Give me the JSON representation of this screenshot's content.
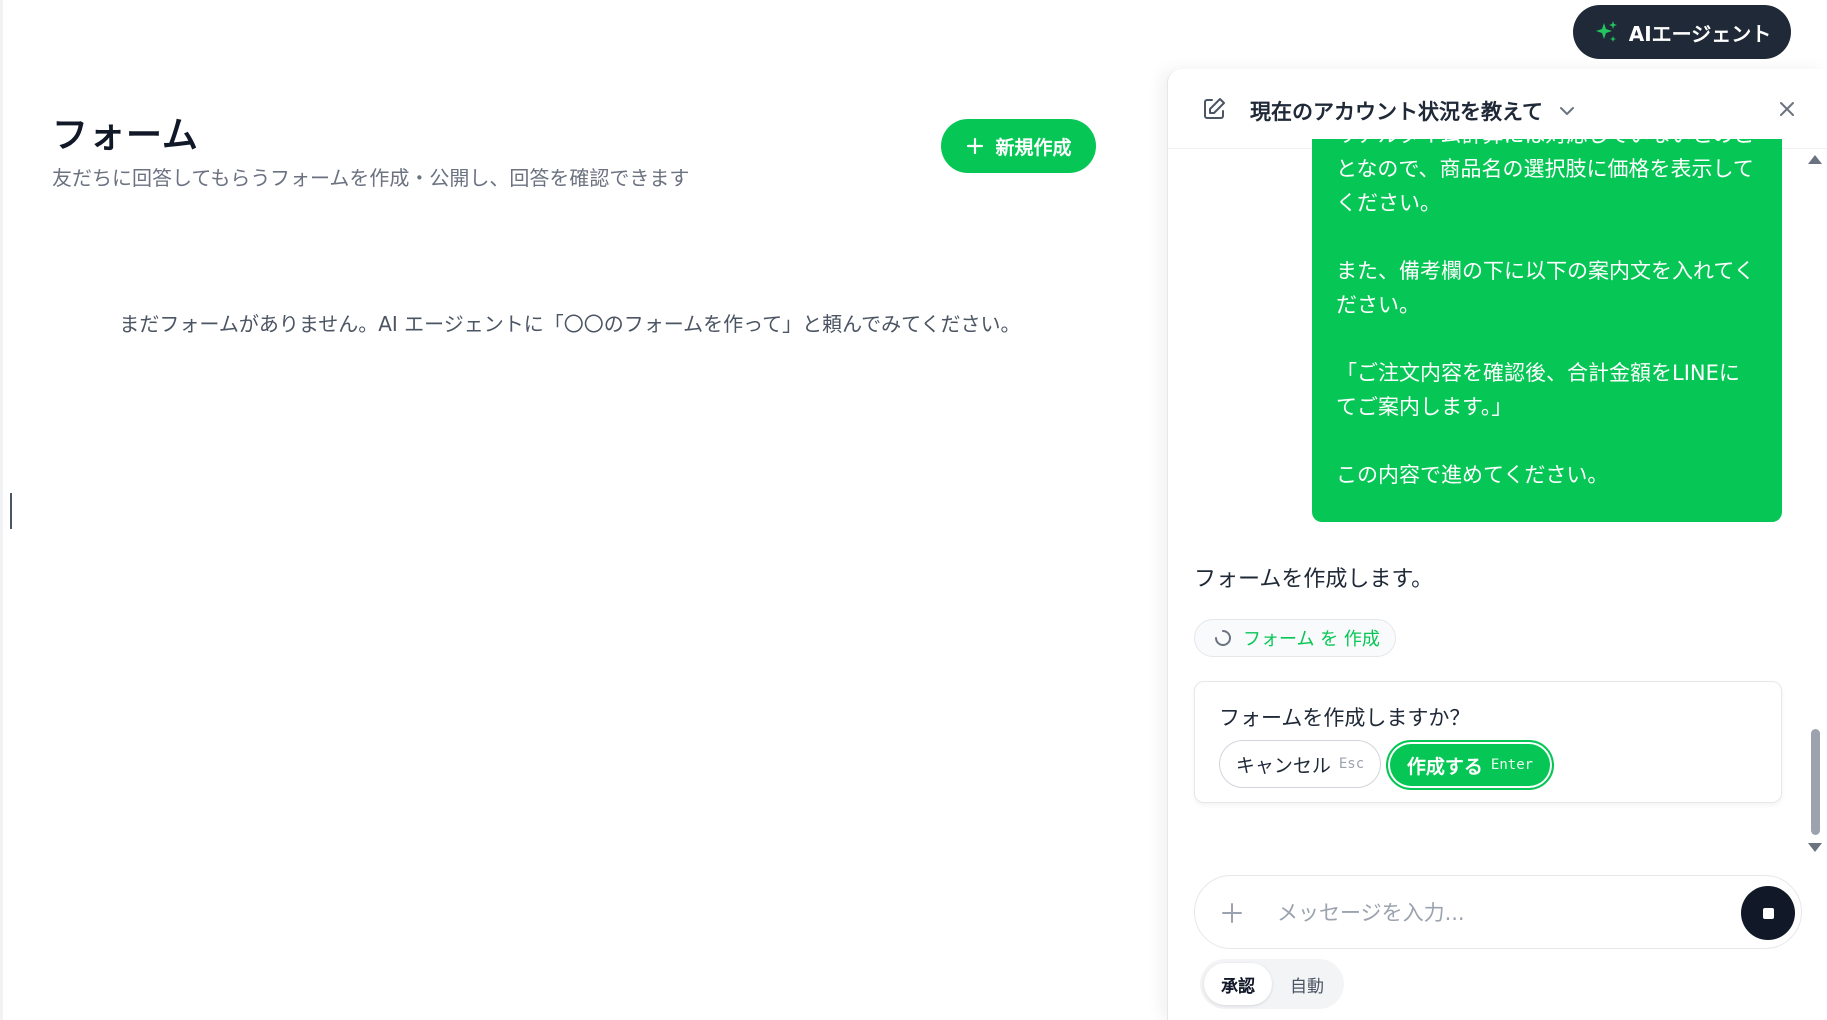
{
  "ai_button": {
    "label": "AIエージェント",
    "icon": "sparkle-icon"
  },
  "main": {
    "title": "フォーム",
    "subtitle": "友だちに回答してもらうフォームを作成・公開し、回答を確認できます",
    "new_button_label": "新規作成",
    "empty_message": "まだフォームがありません。AI エージェントに「〇〇のフォームを作って」と頼んでみてください。"
  },
  "panel": {
    "title": "現在のアカウント状況を教えて",
    "user_message": {
      "clipped_line": "リアルタイム計算には対応していないとのこ",
      "lines": [
        "となので、商品名の選択肢に価格を表示して",
        "ください。",
        "",
        "また、備考欄の下に以下の案内文を入れてく",
        "ださい。",
        "",
        "「ご注文内容を確認後、合計金額をLINEに",
        "てご案内します。」",
        "",
        "この内容で進めてください。"
      ]
    },
    "assistant_message": "フォームを作成します。",
    "tool_chip_label": "フォーム を 作成",
    "confirm": {
      "question": "フォームを作成しますか？",
      "cancel_label": "キャンセル",
      "cancel_key": "Esc",
      "create_label": "作成する",
      "create_key": "Enter"
    },
    "input": {
      "placeholder": "メッセージを入力...",
      "value": ""
    },
    "mode": {
      "approve_label": "承認",
      "auto_label": "自動",
      "selected": "承認"
    }
  },
  "colors": {
    "accent": "#06c755",
    "dark": "#1f2937",
    "muted": "#6b7280"
  }
}
